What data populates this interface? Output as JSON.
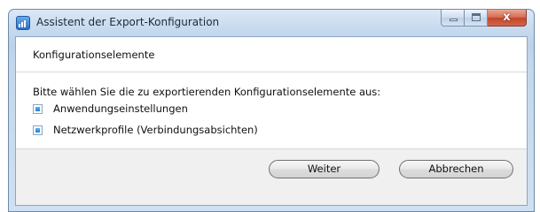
{
  "window": {
    "title": "Assistent der Export-Konfiguration",
    "app_icon": "chart-app-icon",
    "close_glyph": "x"
  },
  "section": {
    "title": "Konfigurationselemente",
    "instruction": "Bitte wählen Sie die zu exportierenden Konfigurationselemente aus:"
  },
  "options": [
    {
      "label": "Anwendungseinstellungen",
      "checked": true
    },
    {
      "label": "Netzwerkprofile (Verbindungsabsichten)",
      "checked": true
    }
  ],
  "buttons": {
    "next_label": "Weiter",
    "cancel_label": "Abbrechen"
  },
  "colors": {
    "frame": "#c8dbef",
    "checkbox_fill": "#1f7fd6",
    "close_button": "#c2452a"
  }
}
